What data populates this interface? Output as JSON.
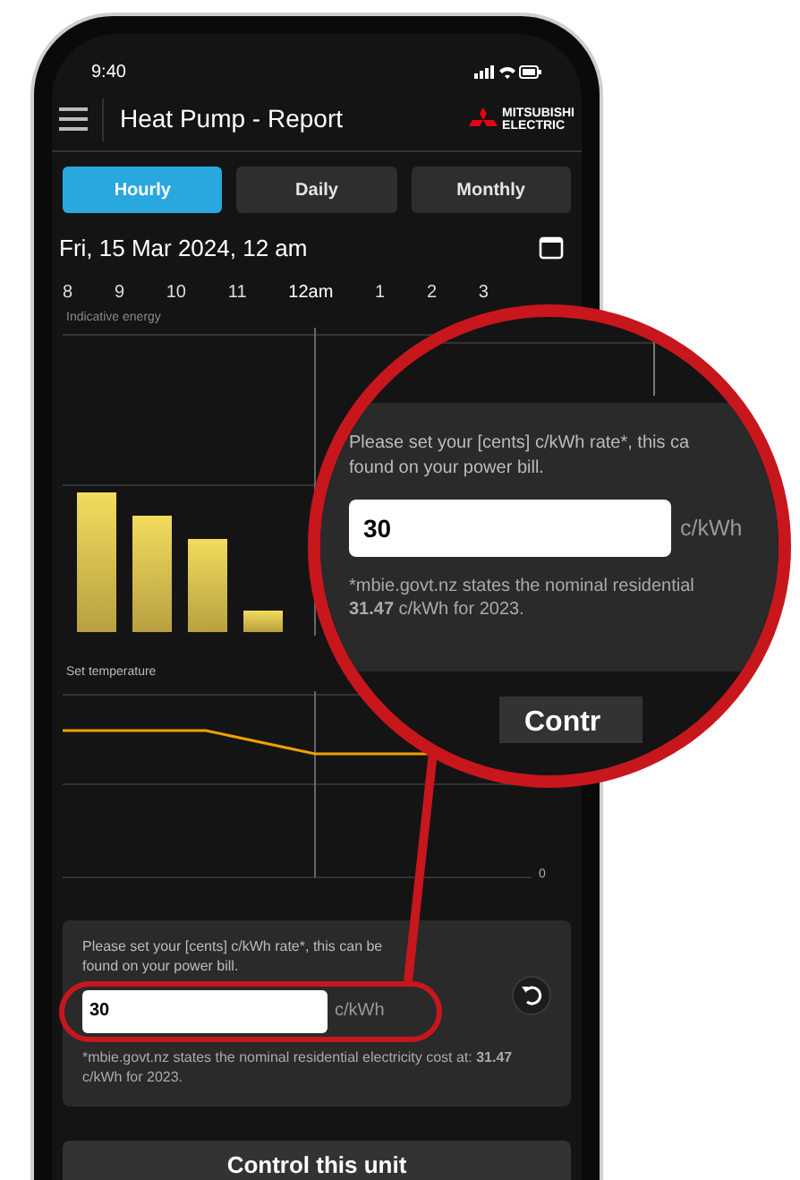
{
  "status_bar": {
    "time": "9:40"
  },
  "header": {
    "title": "Heat Pump - Report",
    "brand_lines": [
      "MITSUBISHI",
      "ELECTRIC"
    ]
  },
  "tabs": [
    {
      "label": "Hourly",
      "selected": true
    },
    {
      "label": "Daily",
      "selected": false
    },
    {
      "label": "Monthly",
      "selected": false
    }
  ],
  "date": "Fri, 15 Mar 2024, 12 am",
  "hours": [
    {
      "label": "8",
      "selected": false
    },
    {
      "label": "9",
      "selected": false
    },
    {
      "label": "10",
      "selected": false
    },
    {
      "label": "11",
      "selected": false
    },
    {
      "label": "12am",
      "selected": true
    },
    {
      "label": "1",
      "selected": false
    },
    {
      "label": "2",
      "selected": false
    },
    {
      "label": "3",
      "selected": false
    }
  ],
  "energy_label": "Indicative energy",
  "temperature_label": "Set temperature",
  "zero_label": "0",
  "rate_panel": {
    "text": "Please set your [cents] c/kWh rate*, this can be found on your power bill.",
    "value": "30",
    "unit": "c/kWh",
    "note": "*mbie.govt.nz states the nominal residential electricity cost at: **31.47** c/kWh for 2023."
  },
  "control_button": "Control this unit",
  "magnifier": {
    "lines": [
      "Please set your [cents] c/kWh rate*, this ca",
      "found on your power bill."
    ],
    "value": "30",
    "unit": "c/kWh",
    "note_lines": [
      "*mbie.govt.nz states the nominal residential",
      "**31.47** c/kWh for 2023."
    ],
    "button": "Contr"
  }
}
